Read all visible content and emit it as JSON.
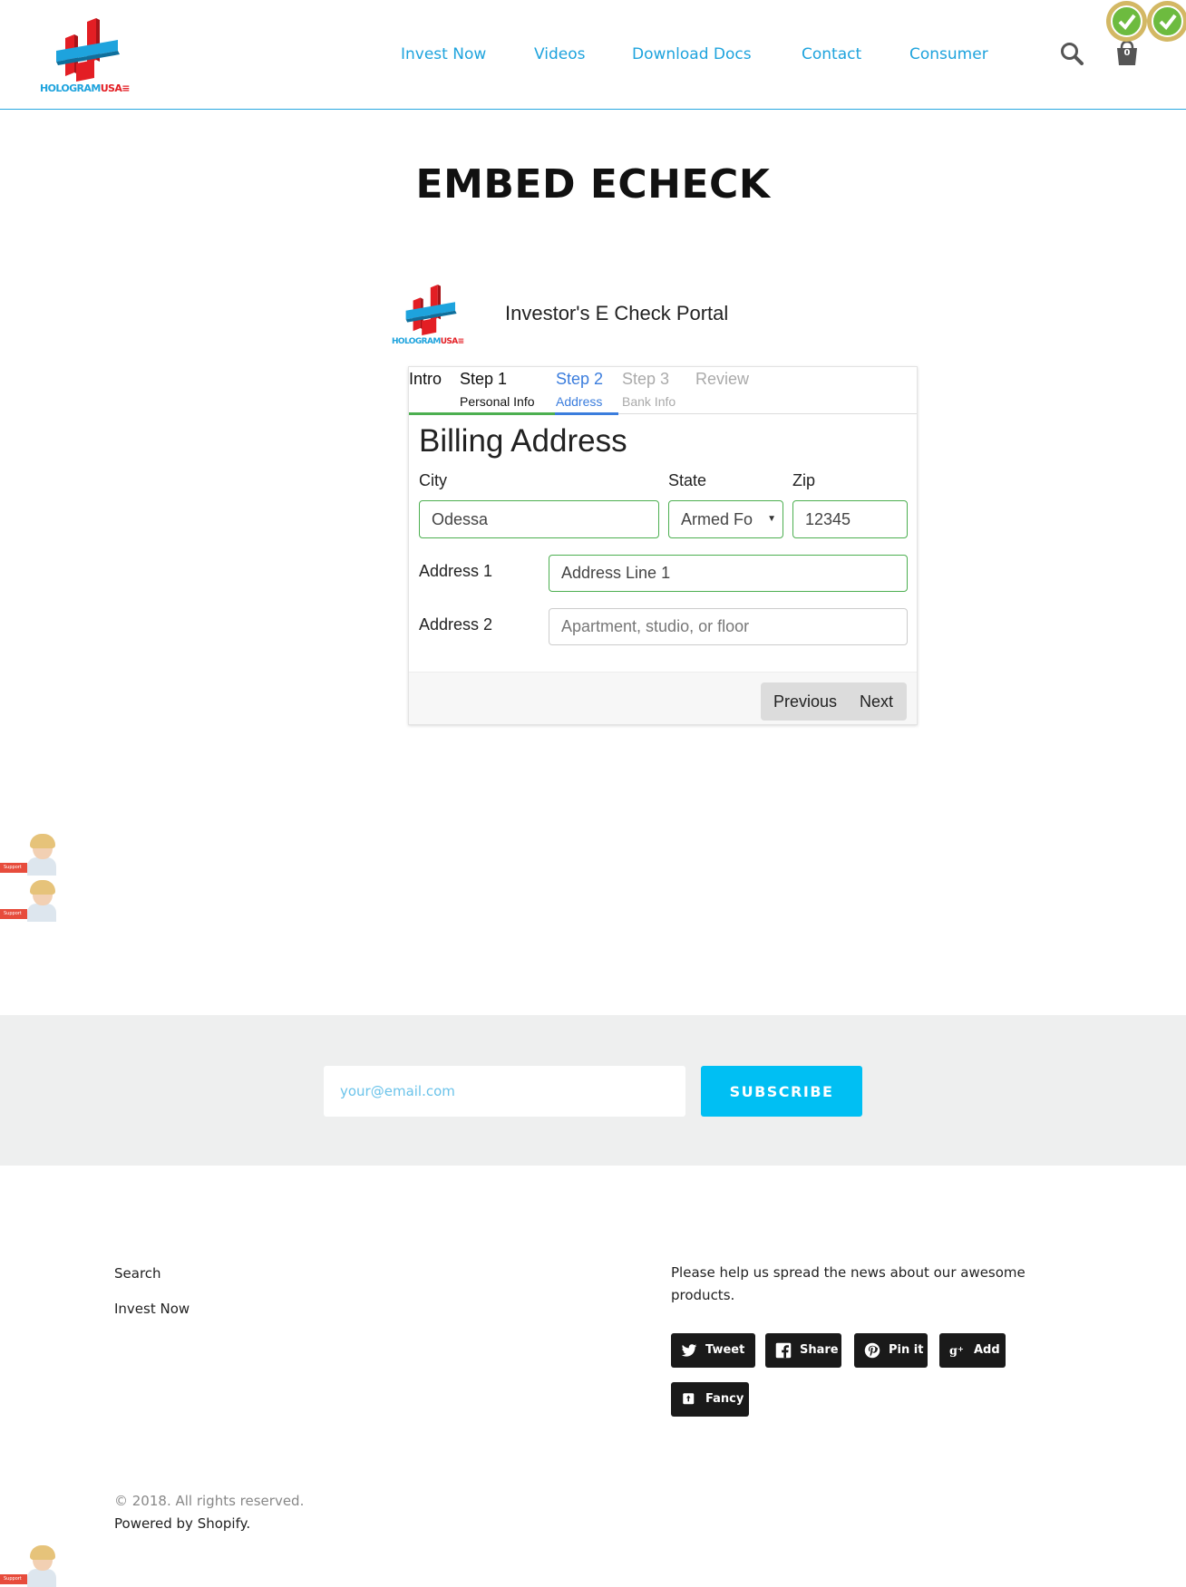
{
  "header": {
    "logo": {
      "holo": "HOLOGRAM",
      "usa": "USA"
    },
    "nav": [
      "Invest Now",
      "Videos",
      "Download Docs",
      "Contact",
      "Consumer"
    ],
    "cart_count": "0",
    "accent": "#1ea3dd",
    "icons": {
      "search": "search-icon",
      "cart": "cart-icon",
      "badge": "verified-badge-icon"
    }
  },
  "page": {
    "title": "EMBED ECHECK"
  },
  "portal": {
    "title": "Investor's E Check Portal",
    "tabs": [
      {
        "main": "Intro",
        "sub": "",
        "state": "complete"
      },
      {
        "main": "Step 1",
        "sub": "Personal Info",
        "state": "complete"
      },
      {
        "main": "Step 2",
        "sub": "Address",
        "state": "active"
      },
      {
        "main": "Step 3",
        "sub": "Bank Info",
        "state": "disabled"
      },
      {
        "main": "Review",
        "sub": "",
        "state": "disabled"
      }
    ],
    "section_title": "Billing Address",
    "labels": {
      "city": "City",
      "state": "State",
      "zip": "Zip",
      "address1": "Address 1",
      "address2": "Address 2"
    },
    "values": {
      "city": "Odessa",
      "state": "Armed Fo",
      "zip": "12345",
      "address1": "Address Line 1"
    },
    "placeholders": {
      "address2": "Apartment, studio, or floor"
    },
    "buttons": {
      "previous": "Previous",
      "next": "Next"
    },
    "colors": {
      "complete": "#4caf50",
      "active": "#3b7ddd",
      "disabled": "#aaaaaa"
    }
  },
  "support": {
    "tag": "Support"
  },
  "newsletter": {
    "placeholder": "your@email.com",
    "button": "SUBSCRIBE",
    "button_color": "#00bff3"
  },
  "footer": {
    "links": [
      "Search",
      "Invest Now"
    ],
    "share_text": "Please help us spread the news about our awesome products.",
    "share_buttons": [
      "Tweet",
      "Share",
      "Pin it",
      "Add",
      "Fancy"
    ],
    "copyright": "© 2018. All rights reserved.",
    "powered": "Powered by Shopify."
  }
}
